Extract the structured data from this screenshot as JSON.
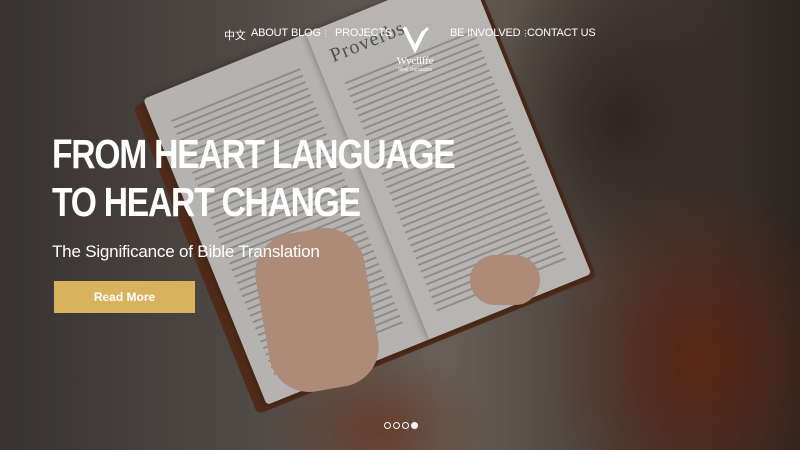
{
  "nav": {
    "items": [
      {
        "label": "中文"
      },
      {
        "label": "ABOUT"
      },
      {
        "label": "BLOG",
        "has_dropdown": true
      },
      {
        "label": "PROJECTS"
      },
      {
        "label": "BE INVOLVED",
        "has_dropdown": true
      },
      {
        "label": "CONTACT US"
      }
    ],
    "dropdown_glyph": "⋮",
    "logo": {
      "name": "Wycliffe",
      "sub": "Bible Translators"
    }
  },
  "hero": {
    "headline_line1": "FROM HEART LANGUAGE",
    "headline_line2": "TO HEART CHANGE",
    "subtitle": "The Significance of Bible Translation",
    "cta_label": "Read More",
    "book_page_heading": "Proverbs"
  },
  "carousel": {
    "count": 4,
    "active_index": 3
  },
  "colors": {
    "accent": "#d9b25d",
    "text": "#ffffff"
  }
}
